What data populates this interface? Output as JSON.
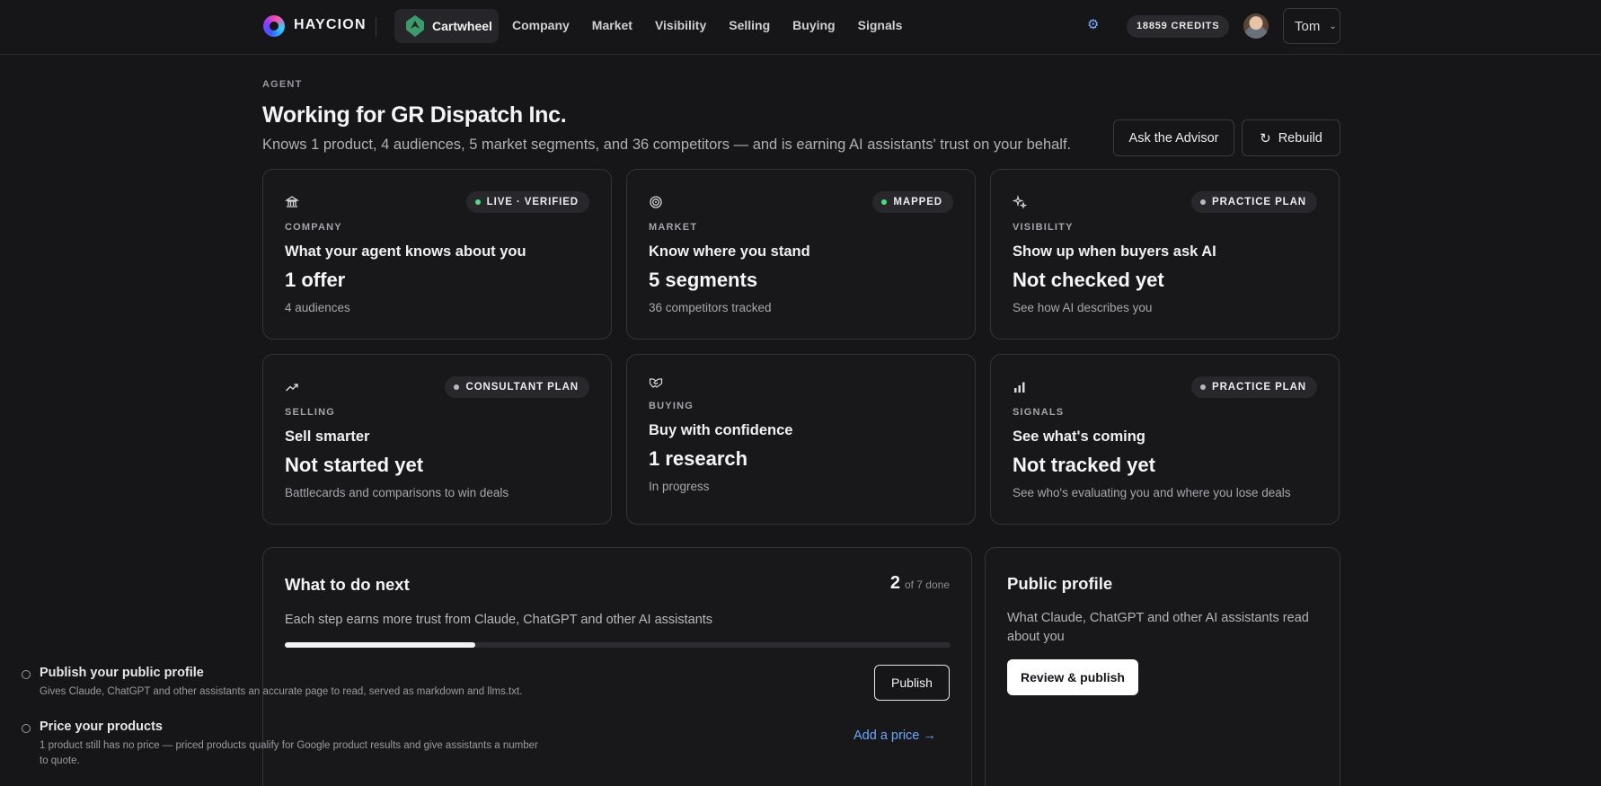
{
  "nav": {
    "brand": "HAYCION",
    "workspace": "Cartwheel",
    "links": [
      "Company",
      "Market",
      "Visibility",
      "Selling",
      "Buying",
      "Signals"
    ],
    "credits": "18859 CREDITS",
    "user": "Tom",
    "accent_color": "#7fa8ff"
  },
  "header": {
    "eyebrow": "AGENT",
    "title": "Working for GR Dispatch Inc.",
    "subtitle": "Knows 1 product, 4 audiences, 5 market segments, and 36 competitors — and is earning AI assistants' trust on your behalf.",
    "advisor_label": "Ask the Advisor",
    "rebuild_label": "Rebuild"
  },
  "cards": [
    {
      "icon": "bank-icon",
      "badge": "LIVE · VERIFIED",
      "badge_color": "#4ade80",
      "category": "COMPANY",
      "heading": "What your agent knows about you",
      "value": "1 offer",
      "sub": "4 audiences"
    },
    {
      "icon": "target-icon",
      "badge": "MAPPED",
      "badge_color": "#4ade80",
      "category": "MARKET",
      "heading": "Know where you stand",
      "value": "5 segments",
      "sub": "36 competitors tracked"
    },
    {
      "icon": "sparkles-icon",
      "badge": "PRACTICE PLAN",
      "badge_color": "#b8b8bd",
      "category": "VISIBILITY",
      "heading": "Show up when buyers ask AI",
      "value": "Not checked yet",
      "sub": "See how AI describes you"
    },
    {
      "icon": "trend-up-icon",
      "badge": "CONSULTANT PLAN",
      "badge_color": "#b8b8bd",
      "category": "SELLING",
      "heading": "Sell smarter",
      "value": "Not started yet",
      "sub": "Battlecards and comparisons to win deals"
    },
    {
      "icon": "handshake-icon",
      "badge": "",
      "badge_color": "",
      "category": "BUYING",
      "heading": "Buy with confidence",
      "value": "1 research",
      "sub": "In progress"
    },
    {
      "icon": "bar-chart-icon",
      "badge": "PRACTICE PLAN",
      "badge_color": "#b8b8bd",
      "category": "SIGNALS",
      "heading": "See what's coming",
      "value": "Not tracked yet",
      "sub": "See who's evaluating you and where you lose deals"
    }
  ],
  "next": {
    "title": "What to do next",
    "done": "2",
    "of_total": "of 7 done",
    "progress_fraction": 0.2857,
    "description": "Each step earns more trust from Claude, ChatGPT and other AI assistants",
    "steps": [
      {
        "title": "Publish your public profile",
        "desc": "Gives Claude, ChatGPT and other assistants an accurate page to read, served as markdown and llms.txt.",
        "action": "Publish"
      },
      {
        "title": "Price your products",
        "desc": "1 product still has no price — priced products qualify for Google product results and give assistants a number to quote.",
        "action": "Add a price →"
      }
    ]
  },
  "profile": {
    "title": "Public profile",
    "description": "What Claude, ChatGPT and other AI assistants read about you",
    "button": "Review & publish"
  }
}
